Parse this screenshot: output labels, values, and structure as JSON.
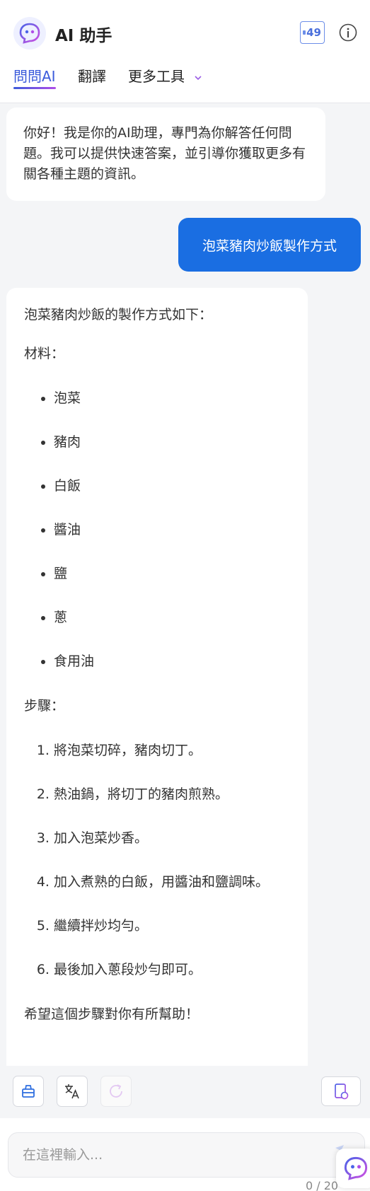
{
  "header": {
    "title": "AI 助手",
    "credits": "49",
    "logo_icon": "ai-robot-face",
    "info_icon": "info-circle"
  },
  "tabs": [
    {
      "label": "問問AI",
      "active": true
    },
    {
      "label": "翻譯",
      "active": false
    },
    {
      "label": "更多工具",
      "active": false,
      "dropdown": true
    }
  ],
  "chat": {
    "greeting": "你好！我是你的AI助理，專門為你解答任何問題。我可以提供快速答案，並引導你獲取更多有關各種主題的資訊。",
    "user_message": "泡菜豬肉炒飯製作方式",
    "answer": {
      "intro": "泡菜豬肉炒飯的製作方式如下：",
      "ingredients_heading": "材料：",
      "ingredients": [
        "泡菜",
        "豬肉",
        "白飯",
        "醬油",
        "鹽",
        "蔥",
        "食用油"
      ],
      "steps_heading": "步驟：",
      "steps": [
        "將泡菜切碎，豬肉切丁。",
        "熱油鍋，將切丁的豬肉煎熟。",
        "加入泡菜炒香。",
        "加入煮熟的白飯，用醬油和鹽調味。",
        "繼續拌炒均勻。",
        "最後加入蔥段炒勻即可。"
      ],
      "closing": "希望這個步驟對你有所幫助！"
    }
  },
  "toolbar": {
    "buttons": [
      "clear-chat-icon",
      "translate-icon",
      "refresh-icon"
    ],
    "right_button": "summary-doc-icon"
  },
  "input": {
    "placeholder": "在這裡輸入...",
    "char_count": "0 / 20"
  },
  "colors": {
    "accent": "#3b5bdb",
    "user_bubble": "#1a6ee2",
    "gradient_end": "#b04de8"
  }
}
